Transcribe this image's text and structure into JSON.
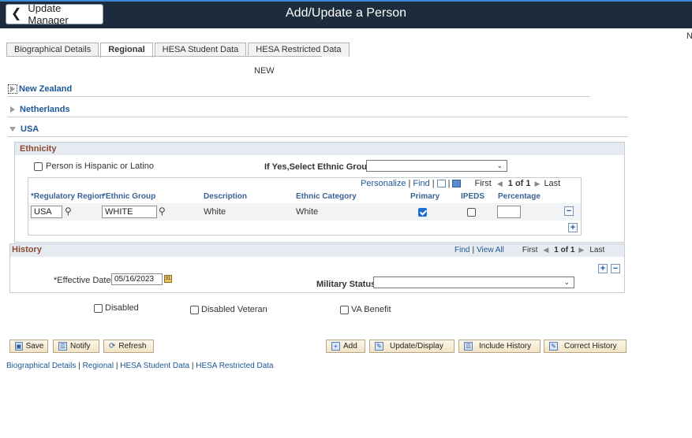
{
  "header": {
    "back_label": "Update Manager",
    "title": "Add/Update a Person",
    "corner_text": "N"
  },
  "tabs": [
    {
      "label": "Biographical Details"
    },
    {
      "label": "Regional"
    },
    {
      "label": "HESA Student Data"
    },
    {
      "label": "HESA Restricted Data"
    }
  ],
  "mode_label": "NEW",
  "sections": {
    "new_zealand": "New Zealand",
    "netherlands": "Netherlands",
    "usa": "USA"
  },
  "ethnicity": {
    "title": "Ethnicity",
    "hispanic_label": "Person is Hispanic or Latino",
    "hispanic_checked": false,
    "select_group_label": "If Yes,Select Ethnic Group",
    "select_group_value": "",
    "grid_nav": {
      "personalize": "Personalize",
      "find": "Find",
      "first": "First",
      "range": "1 of 1",
      "last": "Last"
    },
    "columns": [
      "*Regulatory Region",
      "*Ethnic Group",
      "Description",
      "Ethnic Category",
      "Primary",
      "IPEDS",
      "Percentage"
    ],
    "rows": [
      {
        "region": "USA",
        "group": "WHITE",
        "description": "White",
        "category": "White",
        "primary": true,
        "ipeds": false,
        "percentage": ""
      }
    ]
  },
  "history": {
    "title": "History",
    "find": "Find",
    "view_all": "View All",
    "first": "First",
    "range": "1 of 1",
    "last": "Last",
    "effective_date_label": "*Effective Date",
    "effective_date_value": "05/16/2023",
    "military_status_label": "Military Status",
    "military_status_value": ""
  },
  "flags": {
    "disabled": "Disabled",
    "disabled_veteran": "Disabled Veteran",
    "va_benefit": "VA Benefit"
  },
  "toolbar": {
    "save": "Save",
    "notify": "Notify",
    "refresh": "Refresh",
    "add": "Add",
    "update_display": "Update/Display",
    "include_history": "Include History",
    "correct_history": "Correct History"
  },
  "footer_links": [
    "Biographical Details",
    "Regional",
    "HESA Student Data",
    "HESA Restricted Data"
  ]
}
